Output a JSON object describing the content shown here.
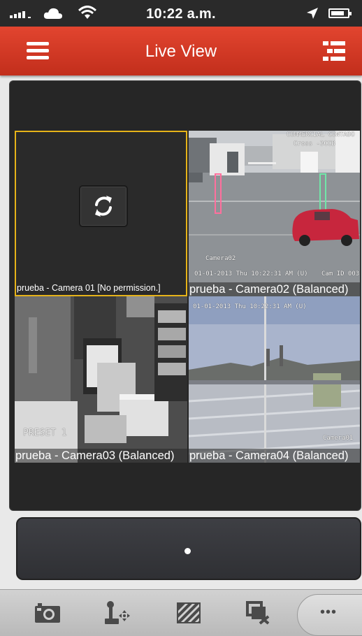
{
  "status_bar": {
    "time": "10:22 a.m.",
    "icons": [
      "signal-icon",
      "cloud-icon",
      "wifi-icon",
      "location-arrow-icon",
      "battery-icon"
    ]
  },
  "header": {
    "title": "Live View",
    "left_icon": "hamburger-menu-icon",
    "right_icon": "list-view-icon",
    "color": "#d63a24"
  },
  "tiles": [
    {
      "label": "prueba - Camera 01 [No permission.]",
      "state": "refresh",
      "selected": true
    },
    {
      "label": "prueba - Camera02 (Balanced)",
      "osd": [
        "Camera02",
        "01-01-2013 Thu 10:22:31 AM (U)",
        "Cam ID 003",
        "COMMERCIAL CONTADO",
        "Cross -3CCB"
      ]
    },
    {
      "label": "prueba - Camera03 (Balanced)",
      "osd": [
        "PRESET 1"
      ]
    },
    {
      "label": "prueba - Camera04 (Balanced)",
      "osd": [
        "01-01-2013 Thu 10:22:31 AM (U)",
        "Camera01"
      ]
    }
  ],
  "pager": {
    "pages": 1,
    "current": 1
  },
  "toolbar": {
    "buttons": [
      "camera-snapshot-icon",
      "ptz-control-icon",
      "image-quality-icon",
      "close-all-icon",
      "more-icon"
    ],
    "more_label": "•••"
  },
  "colors": {
    "accent": "#d63a24",
    "selection": "#e6b319",
    "background": "#262626"
  }
}
